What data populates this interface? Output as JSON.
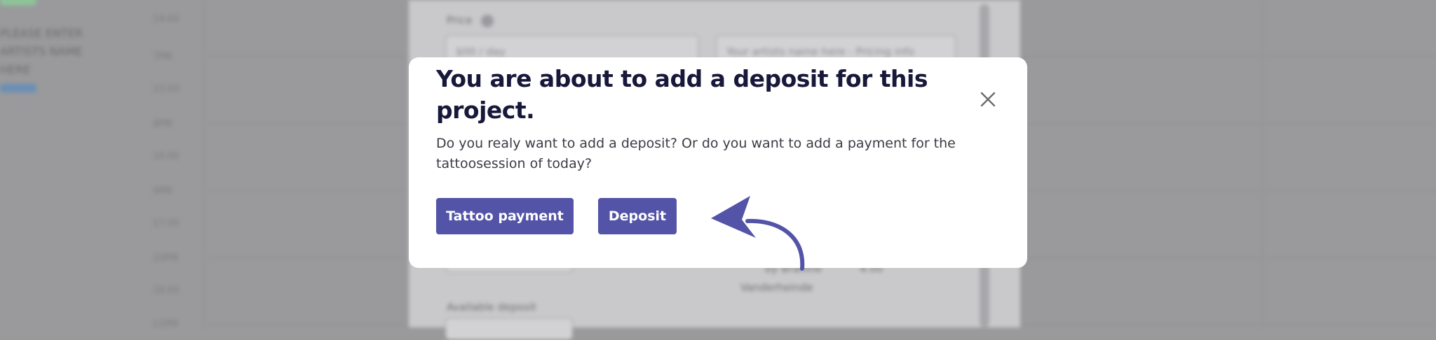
{
  "background": {
    "left_texts": [
      "PLEASE ENTER",
      "ARTISTS NAME",
      "HERE"
    ],
    "times": [
      "14:00",
      "7PM",
      "15:00",
      "8PM",
      "16:00",
      "9PM",
      "17:00",
      "10PM",
      "18:00",
      "11PM"
    ],
    "price_label": "Price",
    "price_value": "$00 / day",
    "pricing_info": "Your artists name here - Pricing info",
    "available_deposit_label": "Available deposit",
    "artist_name_line1": "by Brahine",
    "artist_name_line2": "Vanderheinde",
    "side_value": "4.00"
  },
  "modal": {
    "title": "You are about to add a deposit for this project.",
    "body": "Do you realy want to add a deposit? Or do you want to add a payment for the tattoosession of today?",
    "tattoo_payment_label": "Tattoo payment",
    "deposit_label": "Deposit",
    "close_icon": "close-icon",
    "arrow_icon": "curved-arrow-icon"
  },
  "colors": {
    "accent": "#5353a8",
    "title": "#18183a",
    "overlay": "#9a9a9c"
  }
}
